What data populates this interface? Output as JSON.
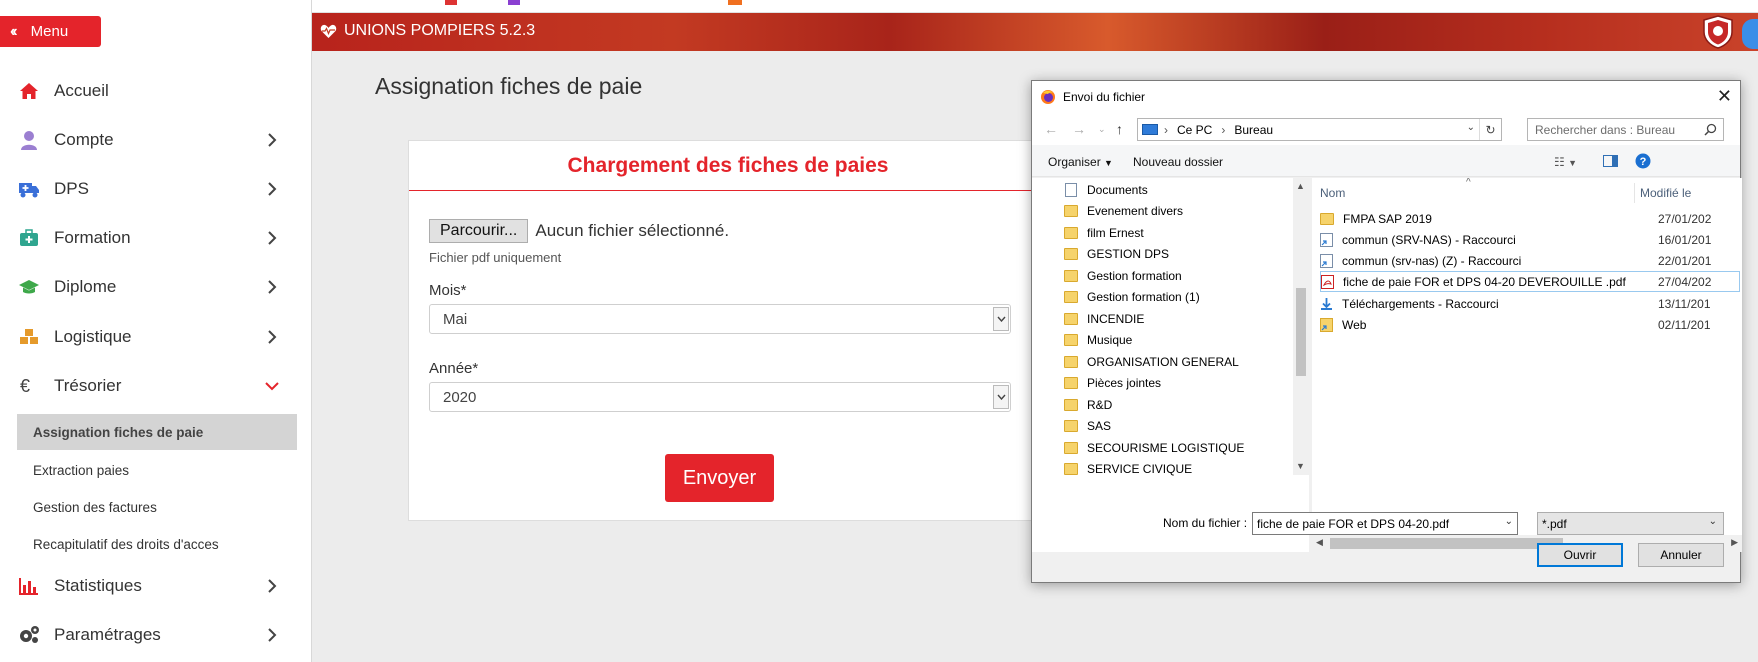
{
  "app": {
    "menu_label": "Menu",
    "header_title": "UNIONS POMPIERS 5.2.3",
    "accent": "#e4242b"
  },
  "sidebar": {
    "items": [
      {
        "label": "Accueil",
        "icon": "home-icon"
      },
      {
        "label": "Compte",
        "icon": "user-icon"
      },
      {
        "label": "DPS",
        "icon": "ambulance-icon"
      },
      {
        "label": "Formation",
        "icon": "medkit-icon"
      },
      {
        "label": "Diplome",
        "icon": "graduation-cap-icon"
      },
      {
        "label": "Logistique",
        "icon": "cubes-icon"
      },
      {
        "label": "Trésorier",
        "icon": "euro-icon"
      },
      {
        "label": "Statistiques",
        "icon": "bar-chart-icon"
      },
      {
        "label": "Paramétrages",
        "icon": "gears-icon"
      }
    ],
    "tresorier_sub": [
      {
        "label": "Assignation fiches de paie",
        "active": true
      },
      {
        "label": "Extraction paies"
      },
      {
        "label": "Gestion des factures"
      },
      {
        "label": "Recapitulatif des droits d'acces"
      }
    ]
  },
  "main": {
    "page_title": "Assignation fiches de paie",
    "card_title": "Chargement des fiches de paies",
    "browse_label": "Parcourir...",
    "no_file": "Aucun fichier sélectionné.",
    "hint": "Fichier pdf uniquement",
    "month_label": "Mois*",
    "month_value": "Mai",
    "year_label": "Année*",
    "year_value": "2020",
    "send_label": "Envoyer"
  },
  "dialog": {
    "title": "Envoi du fichier",
    "path": [
      "Ce PC",
      "Bureau"
    ],
    "search_placeholder": "Rechercher dans : Bureau",
    "organize_label": "Organiser",
    "new_folder_label": "Nouveau dossier",
    "tree": [
      {
        "label": "Documents",
        "type": "doc"
      },
      {
        "label": "Evenement divers",
        "type": "folder"
      },
      {
        "label": "film Ernest",
        "type": "folder"
      },
      {
        "label": "GESTION DPS",
        "type": "folder"
      },
      {
        "label": "Gestion formation",
        "type": "folder"
      },
      {
        "label": "Gestion formation (1)",
        "type": "folder"
      },
      {
        "label": "INCENDIE",
        "type": "folder"
      },
      {
        "label": "Musique",
        "type": "folder"
      },
      {
        "label": "ORGANISATION GENERAL",
        "type": "folder"
      },
      {
        "label": "Pièces jointes",
        "type": "folder"
      },
      {
        "label": "R&D",
        "type": "folder"
      },
      {
        "label": "SAS",
        "type": "folder"
      },
      {
        "label": "SECOURISME LOGISTIQUE",
        "type": "folder"
      },
      {
        "label": "SERVICE CIVIQUE",
        "type": "folder"
      }
    ],
    "col_name": "Nom",
    "col_modified": "Modifié le",
    "files": [
      {
        "name": "FMPA SAP 2019",
        "date": "27/01/202",
        "type": "folder"
      },
      {
        "name": "commun (SRV-NAS) - Raccourci",
        "date": "16/01/201",
        "type": "shortcut"
      },
      {
        "name": "commun (srv-nas) (Z) - Raccourci",
        "date": "22/01/201",
        "type": "shortcut"
      },
      {
        "name": "fiche de paie FOR et DPS 04-20 DEVEROUILLE .pdf",
        "date": "27/04/202",
        "type": "pdf",
        "selected": true
      },
      {
        "name": "Téléchargements - Raccourci",
        "date": "13/11/201",
        "type": "shortcut-dl"
      },
      {
        "name": "Web",
        "date": "02/11/201",
        "type": "shortcut"
      }
    ],
    "filename_label": "Nom du fichier :",
    "filename_value": "fiche de paie FOR et DPS 04-20.pdf",
    "filetype_value": "*.pdf",
    "open_label": "Ouvrir",
    "cancel_label": "Annuler"
  }
}
